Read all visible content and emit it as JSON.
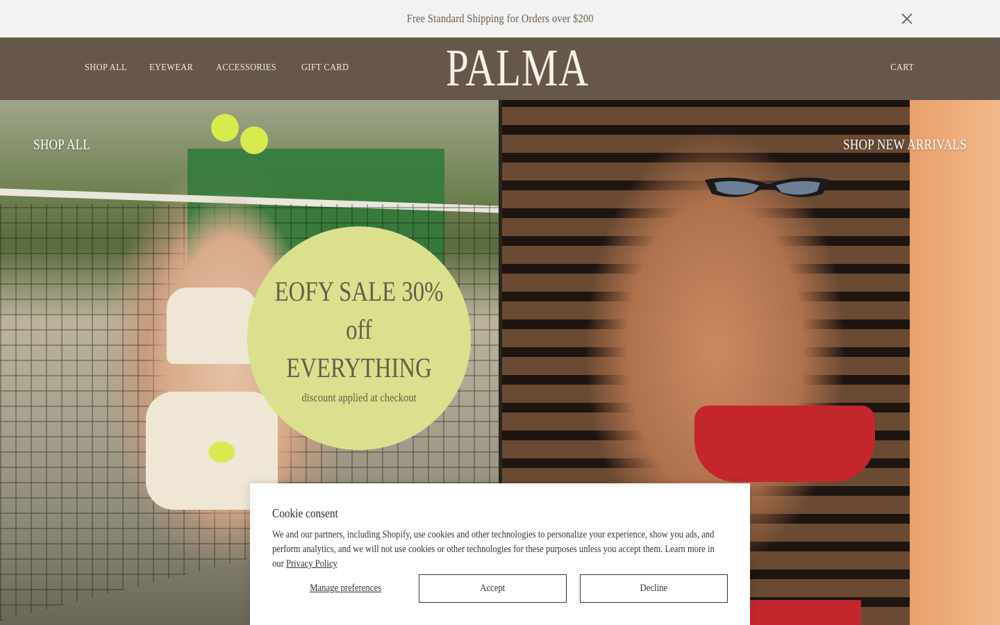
{
  "announcement": {
    "text": "Free Standard Shipping for Orders over $200",
    "close_icon": "close-icon"
  },
  "header": {
    "nav": [
      "SHOP ALL",
      "EYEWEAR",
      "ACCESSORIES",
      "GIFT CARD"
    ],
    "logo": "PALMA",
    "cart": "CART"
  },
  "hero": {
    "left_link": "SHOP ALL",
    "right_link": "SHOP NEW ARRIVALS",
    "badge": {
      "title": "EOFY SALE 30% off EVERYTHING",
      "subtitle": "discount applied at checkout"
    }
  },
  "cookie": {
    "title": "Cookie consent",
    "body": "We and our partners, including Shopify, use cookies and other technologies to personalize your experience, show you ads, and perform analytics, and we will not use cookies or other technologies for these purposes unless you accept them. Learn more in our",
    "privacy_link": "Privacy Policy",
    "manage": "Manage preferences",
    "accept": "Accept",
    "decline": "Decline"
  },
  "colors": {
    "header_bg": "#66574a",
    "announce_bg": "#f2f2f2",
    "badge_bg": "#dbe08e",
    "text_brown": "#6b5a4b"
  }
}
